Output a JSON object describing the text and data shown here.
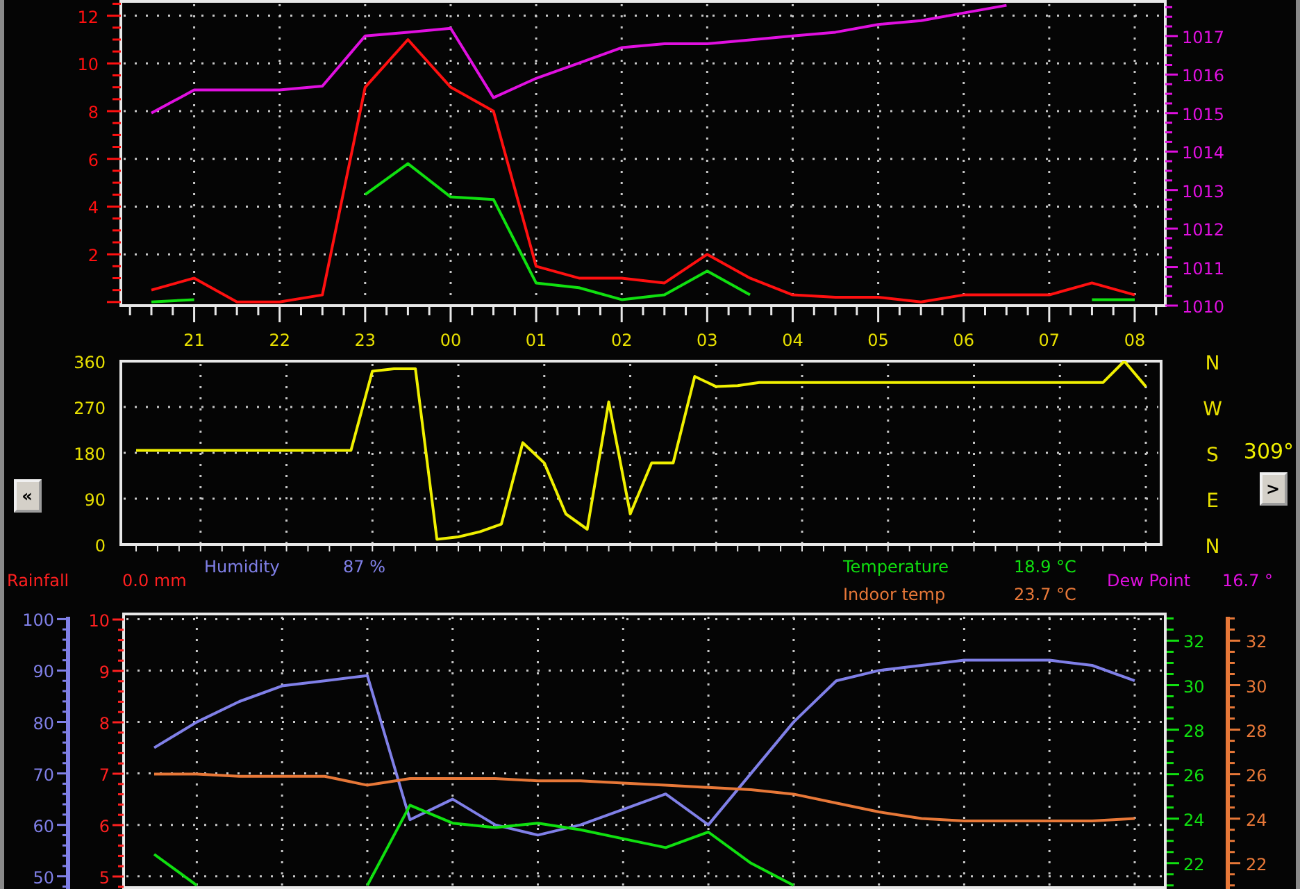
{
  "wind_chart": {
    "chart_data": {
      "type": "line",
      "grid": true,
      "categories": [
        null,
        "21",
        null,
        "22",
        null,
        "23",
        null,
        "00",
        null,
        "01",
        null,
        "02",
        null,
        "03",
        null,
        "04",
        null,
        "05",
        null,
        "06",
        null,
        "07",
        null,
        "08"
      ],
      "ylim": [
        -0.15,
        12.6
      ],
      "yticks": [
        2,
        4,
        6,
        8,
        10,
        12
      ],
      "series": [
        {
          "color": "#ff1010",
          "values": [
            0.5,
            1,
            0,
            0,
            0.3,
            9,
            11,
            9,
            8,
            1.5,
            1,
            1,
            0.8,
            2,
            1,
            0.3,
            0.2,
            0.2,
            0,
            0.3,
            0.3,
            0.3,
            0.8,
            0.3
          ]
        },
        {
          "color": "#10e010",
          "values": [
            0,
            0.1,
            null,
            null,
            null,
            4.5,
            5.8,
            4.4,
            4.3,
            0.8,
            0.6,
            0.1,
            0.3,
            1.3,
            0.3,
            null,
            null,
            null,
            null,
            null,
            null,
            null,
            0.1,
            0.1
          ]
        }
      ]
    }
  },
  "pressure_chart": {
    "chart_data": {
      "type": "line",
      "categories": [
        null,
        null,
        null,
        null,
        null,
        null,
        null,
        null,
        null,
        null,
        null,
        null,
        null,
        null,
        null,
        null,
        null,
        null,
        null,
        null,
        null,
        null,
        null,
        null
      ],
      "ylim": [
        1010,
        1017.9
      ],
      "yticks": [
        1010,
        1011,
        1012,
        1013,
        1014,
        1015,
        1016,
        1017
      ],
      "series": [
        {
          "color": "#e010e0",
          "values": [
            1015,
            1015.6,
            1015.6,
            1015.6,
            1015.7,
            1017,
            1017.1,
            1017.2,
            1015.4,
            1015.9,
            1016.3,
            1016.7,
            1016.8,
            1016.8,
            1016.9,
            1017,
            1017.1,
            1017.3,
            1017.4,
            1017.6,
            1017.8,
            null,
            null,
            null
          ]
        }
      ]
    }
  },
  "direction_chart": {
    "chart_data": {
      "type": "line",
      "grid": true,
      "categories": [
        null,
        null,
        null,
        null,
        null,
        null,
        null,
        null,
        null,
        null,
        null,
        null,
        null,
        null,
        null,
        null,
        null,
        null,
        null,
        null,
        null,
        null,
        null,
        null,
        null,
        null,
        null,
        null,
        null,
        null,
        null,
        null,
        null,
        null,
        null,
        null,
        null,
        null,
        null,
        null,
        null,
        null,
        null,
        null,
        null,
        null,
        null,
        null
      ],
      "ylim": [
        0,
        360
      ],
      "yticks": [
        0,
        90,
        180,
        270,
        360
      ],
      "series": [
        {
          "color": "#f0f000",
          "values": [
            185,
            185,
            185,
            185,
            185,
            185,
            185,
            185,
            185,
            185,
            185,
            340,
            345,
            345,
            10,
            15,
            25,
            40,
            200,
            160,
            60,
            30,
            280,
            60,
            160,
            160,
            330,
            310,
            312,
            318,
            318,
            318,
            318,
            318,
            318,
            318,
            318,
            318,
            318,
            318,
            318,
            318,
            318,
            318,
            318,
            318,
            360,
            310
          ]
        }
      ]
    },
    "compass": [
      "N",
      "W",
      "S",
      "E",
      "N"
    ],
    "reading": "309°",
    "back_button": "«",
    "forward_button": ">"
  },
  "legend": [
    {
      "label": "Rainfall",
      "value": "0.0 mm",
      "color": "#ff2020"
    },
    {
      "label": "Humidity",
      "value": "87 %",
      "color": "#8080e8"
    },
    {
      "label": "Temperature",
      "value": "18.9 °C",
      "color": "#10e010"
    },
    {
      "label": "Indoor temp",
      "value": "23.7 °C",
      "color": "#e87838"
    },
    {
      "label": "Dew Point",
      "value": "16.7 °",
      "color": "#e010e0"
    }
  ],
  "humidity_chart": {
    "chart_data": {
      "type": "line",
      "grid": true,
      "categories": [
        null,
        null,
        null,
        null,
        null,
        null,
        null,
        null,
        null,
        null,
        null,
        null,
        null,
        null,
        null,
        null,
        null,
        null,
        null,
        null,
        null,
        null,
        null,
        null
      ],
      "ylim": [
        47.8,
        101
      ],
      "yticks": [
        50,
        60,
        70,
        80,
        90,
        100
      ],
      "series": [
        {
          "color": "#8080e8",
          "values": [
            75,
            80,
            84,
            87,
            88,
            89,
            61,
            65,
            60,
            58,
            60,
            63,
            66,
            60,
            70,
            80,
            88,
            90,
            91,
            92,
            92,
            92,
            91,
            88
          ]
        }
      ]
    },
    "rain_axis": {
      "color": "#ff2020",
      "ticks": [
        "10",
        "9",
        "8",
        "7",
        "6",
        "5"
      ]
    }
  },
  "temperature_chart": {
    "chart_data": {
      "type": "line",
      "categories": [
        null,
        null,
        null,
        null,
        null,
        null,
        null,
        null,
        null,
        null,
        null,
        null,
        null,
        null,
        null,
        null,
        null,
        null,
        null,
        null,
        null,
        null,
        null,
        null
      ],
      "ylim": [
        20.9,
        33.2
      ],
      "yticks": [
        22,
        24,
        26,
        28,
        30,
        32
      ],
      "series": [
        {
          "color": "#10e010",
          "values": [
            22.4,
            21,
            null,
            null,
            null,
            21,
            24.6,
            23.8,
            23.6,
            23.8,
            23.5,
            23.1,
            22.7,
            23.4,
            22,
            21,
            null,
            null,
            null,
            null,
            null,
            null,
            null,
            null
          ]
        }
      ]
    }
  },
  "indoor_temp_chart": {
    "chart_data": {
      "type": "line",
      "categories": [
        null,
        null,
        null,
        null,
        null,
        null,
        null,
        null,
        null,
        null,
        null,
        null,
        null,
        null,
        null,
        null,
        null,
        null,
        null,
        null,
        null,
        null,
        null,
        null
      ],
      "ylim": [
        20.9,
        33.2
      ],
      "yticks": [
        22,
        24,
        26,
        28,
        30,
        32
      ],
      "series": [
        {
          "color": "#e87838",
          "values": [
            26,
            26,
            25.9,
            25.9,
            25.9,
            25.5,
            25.8,
            25.8,
            25.8,
            25.7,
            25.7,
            25.6,
            25.5,
            25.4,
            25.3,
            25.1,
            24.7,
            24.3,
            24,
            23.9,
            23.9,
            23.9,
            23.9,
            24
          ]
        }
      ]
    }
  }
}
